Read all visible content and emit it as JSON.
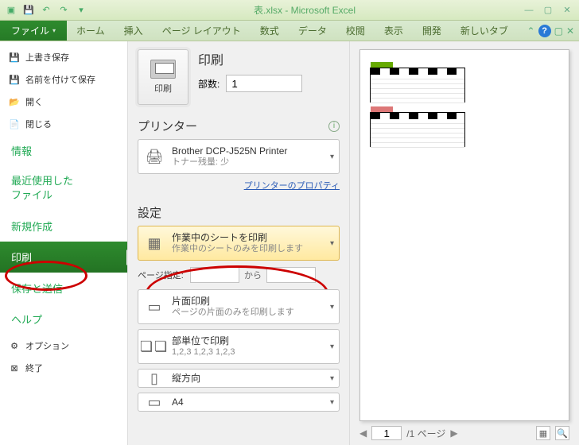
{
  "titlebar": {
    "title": "表.xlsx - Microsoft Excel"
  },
  "ribbon": {
    "file": "ファイル",
    "tabs": [
      "ホーム",
      "挿入",
      "ページ レイアウト",
      "数式",
      "データ",
      "校閲",
      "表示",
      "開発",
      "新しいタブ"
    ]
  },
  "sidebar": {
    "items_top": [
      {
        "label": "上書き保存",
        "icon": "💾"
      },
      {
        "label": "名前を付けて保存",
        "icon": "💾"
      },
      {
        "label": "開く",
        "icon": "📂"
      },
      {
        "label": "閉じる",
        "icon": "📄"
      }
    ],
    "plain1": "情報",
    "plain2": "最近使用した\nファイル",
    "plain3": "新規作成",
    "selected": "印刷",
    "plain4": "保存と送信",
    "plain5": "ヘルプ",
    "items_bottom": [
      {
        "label": "オプション",
        "icon": "⚙"
      },
      {
        "label": "終了",
        "icon": "⊠"
      }
    ]
  },
  "center": {
    "print_label": "印刷",
    "print_btn_caption": "印刷",
    "copies_label": "部数:",
    "copies_value": "1",
    "printer_head": "プリンター",
    "printer_name": "Brother DCP-J525N Printer",
    "printer_status": "トナー残量: 少",
    "printer_props": "プリンターのプロパティ",
    "settings_head": "設定",
    "scope_t1": "作業中のシートを印刷",
    "scope_t2": "作業中のシートのみを印刷します",
    "pages_lbl": "ページ指定:",
    "pages_to": "から",
    "sides_t1": "片面印刷",
    "sides_t2": "ページの片面のみを印刷します",
    "collate_t1": "部単位で印刷",
    "collate_t2": "1,2,3   1,2,3   1,2,3",
    "orient_t1": "縦方向",
    "paper_t1": "A4"
  },
  "preview": {
    "page_value": "1",
    "page_total": "/1 ページ"
  }
}
